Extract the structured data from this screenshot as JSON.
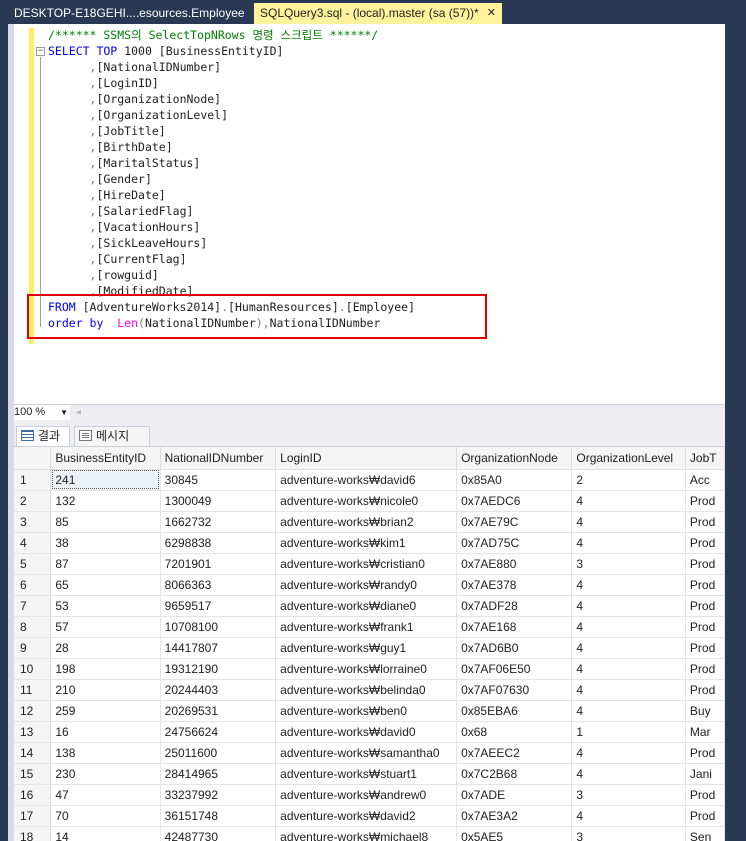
{
  "tabs": {
    "inactive_label": "DESKTOP-E18GEHI....esources.Employee",
    "active_label": "SQLQuery3.sql - (local).master (sa (57))*",
    "close_glyph": "✕"
  },
  "editor": {
    "lines": [
      [
        {
          "t": "/****** SSMS의 SelectTopNRows 명령 스크립트 ******/",
          "c": "cm"
        }
      ],
      [
        {
          "t": "SELECT TOP ",
          "c": "kw"
        },
        {
          "t": "1000 ",
          "c": "tx"
        },
        {
          "t": "[BusinessEntityID]",
          "c": "tx"
        }
      ],
      [
        {
          "t": "      ",
          "c": "tx"
        },
        {
          "t": ",",
          "c": "gr"
        },
        {
          "t": "[NationalIDNumber]",
          "c": "tx"
        }
      ],
      [
        {
          "t": "      ",
          "c": "tx"
        },
        {
          "t": ",",
          "c": "gr"
        },
        {
          "t": "[LoginID]",
          "c": "tx"
        }
      ],
      [
        {
          "t": "      ",
          "c": "tx"
        },
        {
          "t": ",",
          "c": "gr"
        },
        {
          "t": "[OrganizationNode]",
          "c": "tx"
        }
      ],
      [
        {
          "t": "      ",
          "c": "tx"
        },
        {
          "t": ",",
          "c": "gr"
        },
        {
          "t": "[OrganizationLevel]",
          "c": "tx"
        }
      ],
      [
        {
          "t": "      ",
          "c": "tx"
        },
        {
          "t": ",",
          "c": "gr"
        },
        {
          "t": "[JobTitle]",
          "c": "tx"
        }
      ],
      [
        {
          "t": "      ",
          "c": "tx"
        },
        {
          "t": ",",
          "c": "gr"
        },
        {
          "t": "[BirthDate]",
          "c": "tx"
        }
      ],
      [
        {
          "t": "      ",
          "c": "tx"
        },
        {
          "t": ",",
          "c": "gr"
        },
        {
          "t": "[MaritalStatus]",
          "c": "tx"
        }
      ],
      [
        {
          "t": "      ",
          "c": "tx"
        },
        {
          "t": ",",
          "c": "gr"
        },
        {
          "t": "[Gender]",
          "c": "tx"
        }
      ],
      [
        {
          "t": "      ",
          "c": "tx"
        },
        {
          "t": ",",
          "c": "gr"
        },
        {
          "t": "[HireDate]",
          "c": "tx"
        }
      ],
      [
        {
          "t": "      ",
          "c": "tx"
        },
        {
          "t": ",",
          "c": "gr"
        },
        {
          "t": "[SalariedFlag]",
          "c": "tx"
        }
      ],
      [
        {
          "t": "      ",
          "c": "tx"
        },
        {
          "t": ",",
          "c": "gr"
        },
        {
          "t": "[VacationHours]",
          "c": "tx"
        }
      ],
      [
        {
          "t": "      ",
          "c": "tx"
        },
        {
          "t": ",",
          "c": "gr"
        },
        {
          "t": "[SickLeaveHours]",
          "c": "tx"
        }
      ],
      [
        {
          "t": "      ",
          "c": "tx"
        },
        {
          "t": ",",
          "c": "gr"
        },
        {
          "t": "[CurrentFlag]",
          "c": "tx"
        }
      ],
      [
        {
          "t": "      ",
          "c": "tx"
        },
        {
          "t": ",",
          "c": "gr"
        },
        {
          "t": "[rowguid]",
          "c": "tx"
        }
      ],
      [
        {
          "t": "      ",
          "c": "tx"
        },
        {
          "t": ",",
          "c": "gr"
        },
        {
          "t": "[ModifiedDate]",
          "c": "tx"
        }
      ],
      [
        {
          "t": "FROM ",
          "c": "kw"
        },
        {
          "t": "[AdventureWorks2014]",
          "c": "tx"
        },
        {
          "t": ".",
          "c": "gr"
        },
        {
          "t": "[HumanResources]",
          "c": "tx"
        },
        {
          "t": ".",
          "c": "gr"
        },
        {
          "t": "[Employee]",
          "c": "tx"
        }
      ],
      [
        {
          "t": "order by ",
          "c": "kw"
        },
        {
          "t": " ",
          "c": "tx"
        },
        {
          "t": "Len",
          "c": "fn"
        },
        {
          "t": "(",
          "c": "gr"
        },
        {
          "t": "NationalIDNumber",
          "c": "tx"
        },
        {
          "t": "),",
          "c": "gr"
        },
        {
          "t": "NationalIDNumber",
          "c": "tx"
        }
      ]
    ],
    "outline_glyph": "−"
  },
  "zoom": {
    "value": "100 %",
    "arrow": "▼",
    "scroll_glyph": "◂"
  },
  "results_tabs": {
    "results": "결과",
    "messages": "메시지"
  },
  "grid": {
    "columns": [
      "BusinessEntityID",
      "NationalIDNumber",
      "LoginID",
      "OrganizationNode",
      "OrganizationLevel",
      "JobTitle"
    ],
    "column_labels": [
      "BusinessEntityID",
      "NationalIDNumber",
      "LoginID",
      "OrganizationNode",
      "OrganizationLevel",
      "JobT"
    ],
    "rows": [
      [
        "1",
        "241",
        "30845",
        "adventure-works₩david6",
        "0x85A0",
        "2",
        "Acc"
      ],
      [
        "2",
        "132",
        "1300049",
        "adventure-works₩nicole0",
        "0x7AEDC6",
        "4",
        "Prod"
      ],
      [
        "3",
        "85",
        "1662732",
        "adventure-works₩brian2",
        "0x7AE79C",
        "4",
        "Prod"
      ],
      [
        "4",
        "38",
        "6298838",
        "adventure-works₩kim1",
        "0x7AD75C",
        "4",
        "Prod"
      ],
      [
        "5",
        "87",
        "7201901",
        "adventure-works₩cristian0",
        "0x7AE880",
        "3",
        "Prod"
      ],
      [
        "6",
        "65",
        "8066363",
        "adventure-works₩randy0",
        "0x7AE378",
        "4",
        "Prod"
      ],
      [
        "7",
        "53",
        "9659517",
        "adventure-works₩diane0",
        "0x7ADF28",
        "4",
        "Prod"
      ],
      [
        "8",
        "57",
        "10708100",
        "adventure-works₩frank1",
        "0x7AE168",
        "4",
        "Prod"
      ],
      [
        "9",
        "28",
        "14417807",
        "adventure-works₩guy1",
        "0x7AD6B0",
        "4",
        "Prod"
      ],
      [
        "10",
        "198",
        "19312190",
        "adventure-works₩lorraine0",
        "0x7AF06E50",
        "4",
        "Prod"
      ],
      [
        "11",
        "210",
        "20244403",
        "adventure-works₩belinda0",
        "0x7AF07630",
        "4",
        "Prod"
      ],
      [
        "12",
        "259",
        "20269531",
        "adventure-works₩ben0",
        "0x85EBA6",
        "4",
        "Buy"
      ],
      [
        "13",
        "16",
        "24756624",
        "adventure-works₩david0",
        "0x68",
        "1",
        "Mar"
      ],
      [
        "14",
        "138",
        "25011600",
        "adventure-works₩samantha0",
        "0x7AEEC2",
        "4",
        "Prod"
      ],
      [
        "15",
        "230",
        "28414965",
        "adventure-works₩stuart1",
        "0x7C2B68",
        "4",
        "Jani"
      ],
      [
        "16",
        "47",
        "33237992",
        "adventure-works₩andrew0",
        "0x7ADE",
        "3",
        "Prod"
      ],
      [
        "17",
        "70",
        "36151748",
        "adventure-works₩david2",
        "0x7AE3A2",
        "4",
        "Prod"
      ],
      [
        "18",
        "14",
        "42487730",
        "adventure-works₩michael8",
        "0x5AE5",
        "3",
        "Sen"
      ]
    ]
  }
}
